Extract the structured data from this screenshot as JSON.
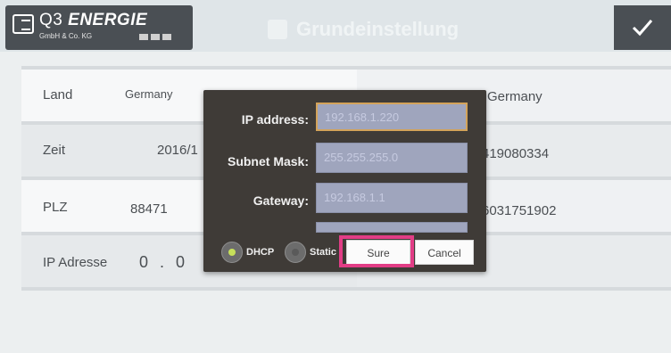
{
  "header": {
    "brand_prefix": "Q3",
    "brand_name": "ENERGIE",
    "brand_sub": "GmbH & Co. KG",
    "title": "Grundeinstellung",
    "confirm_icon": "check-icon"
  },
  "rows": {
    "land": {
      "label": "Land",
      "value": "Germany",
      "right_value": "Germany"
    },
    "zeit": {
      "label": "Zeit",
      "value": "2016/1",
      "right_value": "419080334"
    },
    "plz": {
      "label": "PLZ",
      "value": "88471",
      "right_value": "6031751902"
    },
    "ip": {
      "label": "IP Adresse",
      "value": "0 . 0"
    }
  },
  "dialog": {
    "ip_label": "IP address:",
    "ip_value": "192.168.1.220",
    "subnet_label": "Subnet Mask:",
    "subnet_value": "255.255.255.0",
    "gateway_label": "Gateway:",
    "gateway_value": "192.168.1.1",
    "dhcp_label": "DHCP",
    "static_label": "Static",
    "sure_label": "Sure",
    "cancel_label": "Cancel",
    "colors": {
      "dhcp_selected": "#c7e05a",
      "highlight": "#e23d86"
    }
  }
}
